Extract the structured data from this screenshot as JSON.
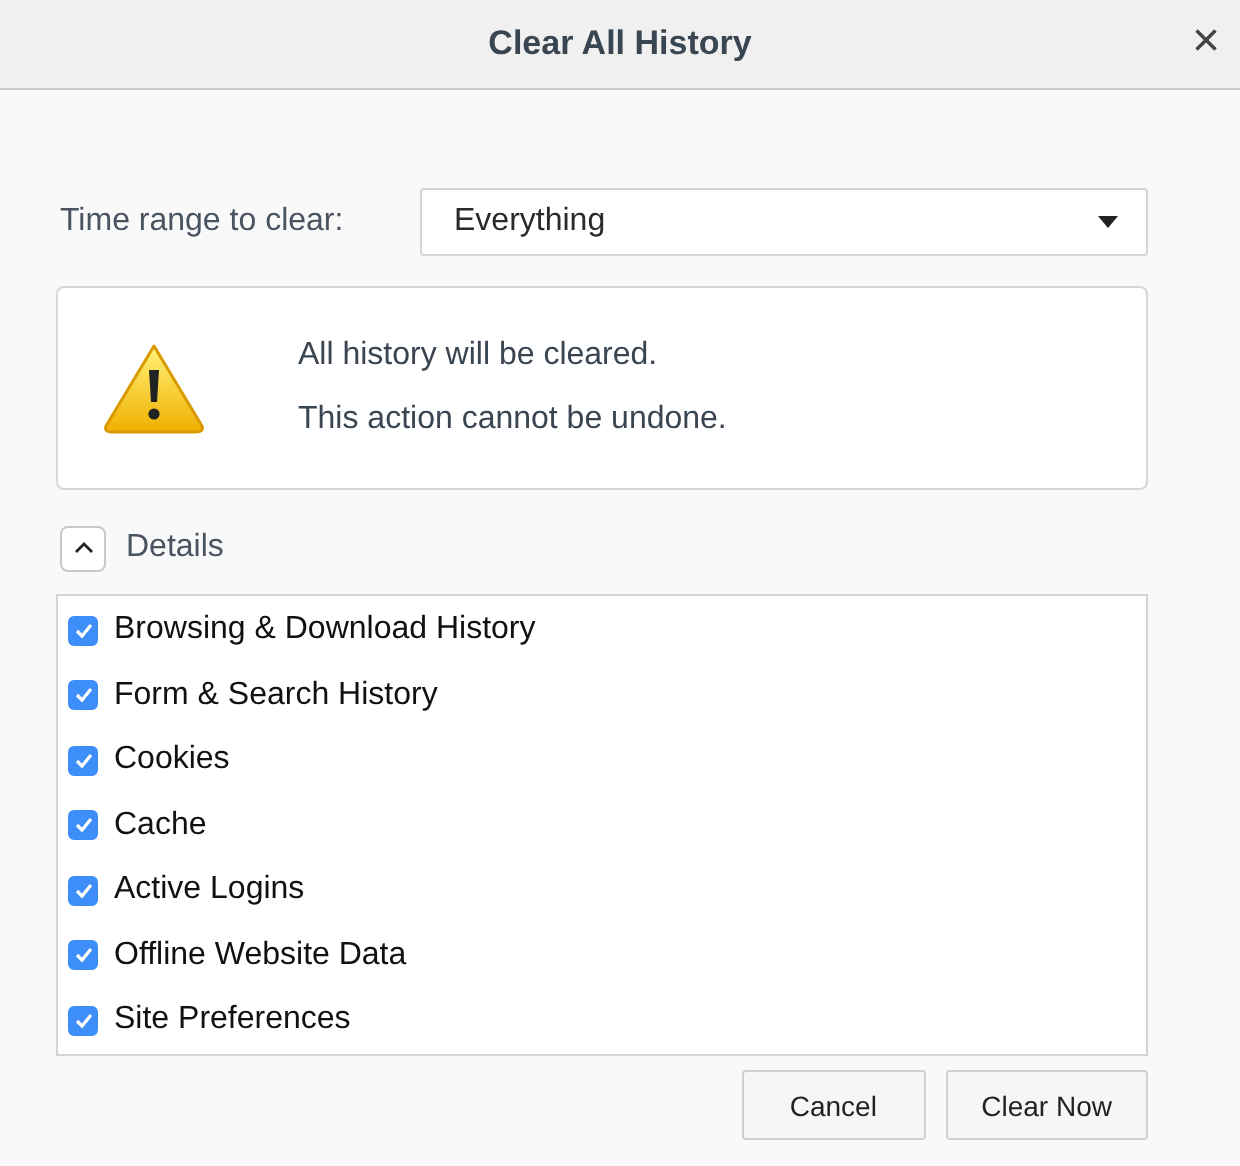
{
  "window": {
    "title": "Clear All History",
    "close": "×"
  },
  "time_range": {
    "label": "Time range to clear:",
    "value": "Everything"
  },
  "warning": {
    "lines": [
      "All history will be cleared.",
      "This action cannot be undone."
    ]
  },
  "details": {
    "label": "Details",
    "expanded": true
  },
  "items": [
    {
      "label": "Browsing & Download History",
      "checked": true
    },
    {
      "label": "Form & Search History",
      "checked": true
    },
    {
      "label": "Cookies",
      "checked": true
    },
    {
      "label": "Cache",
      "checked": true
    },
    {
      "label": "Active Logins",
      "checked": true
    },
    {
      "label": "Offline Website Data",
      "checked": true
    },
    {
      "label": "Site Preferences",
      "checked": true
    }
  ],
  "buttons": [
    "Cancel",
    "Clear Now"
  ]
}
